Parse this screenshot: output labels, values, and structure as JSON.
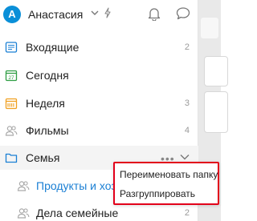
{
  "header": {
    "avatar_letter": "A",
    "user_name": "Анастасия"
  },
  "nav": {
    "items": [
      {
        "label": "Входящие",
        "count": "2",
        "icon": "inbox-icon"
      },
      {
        "label": "Сегодня",
        "count": "",
        "icon": "calendar-today-icon",
        "icon_text": "27"
      },
      {
        "label": "Неделя",
        "count": "3",
        "icon": "calendar-week-icon"
      },
      {
        "label": "Фильмы",
        "count": "4",
        "icon": "shared-people-icon"
      },
      {
        "label": "Семья",
        "count": "",
        "icon": "folder-icon"
      },
      {
        "label": "Продукты и хоз",
        "count": "",
        "icon": "shared-people-icon"
      },
      {
        "label": "Дела семейные",
        "count": "2",
        "icon": "shared-people-icon"
      }
    ],
    "more_dots": "•••"
  },
  "context_menu": {
    "items": [
      {
        "label": "Переименовать папку"
      },
      {
        "label": "Разгруппировать"
      }
    ]
  },
  "colors": {
    "accent": "#0a8fd8",
    "link": "#1a7fd4",
    "highlight_border": "#e2001a",
    "today_icon": "#2f9e44",
    "week_icon": "#f0a020"
  }
}
